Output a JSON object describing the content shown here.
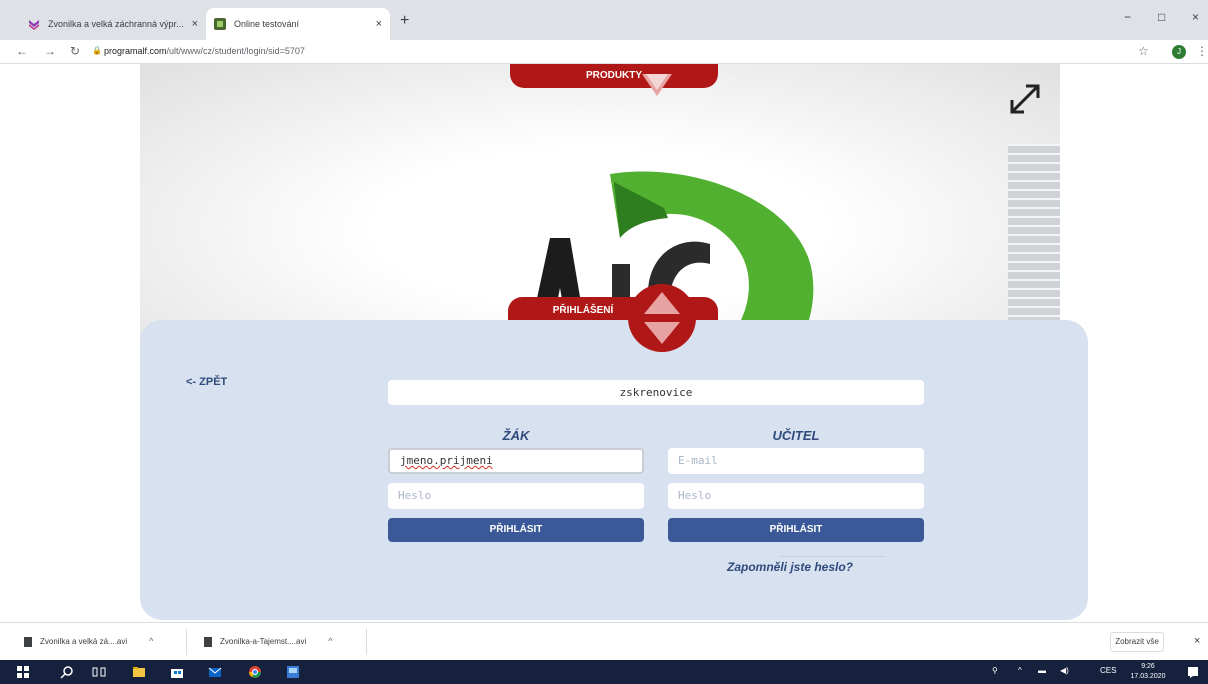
{
  "browser": {
    "tabs": [
      {
        "title": "Zvonilka a velká záchranná výpr...",
        "close": "×"
      },
      {
        "title": "Online testování",
        "close": "×"
      }
    ],
    "new_tab": "+",
    "url_host": "programalf.com",
    "url_path": "/ult/www/cz/student/login/sid=5707",
    "profile_initial": "J",
    "window_controls": {
      "minimize": "−",
      "maximize": "□",
      "close": "×"
    }
  },
  "page": {
    "produkty_label": "PRODUKTY",
    "prihlaseni_label": "PŘIHLÁŠENÍ",
    "back_label": "<- ZPĚT",
    "school_value": "zskrenovice",
    "student": {
      "heading": "ŽÁK",
      "name_value": "jmeno.prijmeni",
      "password_placeholder": "Heslo",
      "submit_label": "PŘIHLÁSIT"
    },
    "teacher": {
      "heading": "UČITEL",
      "email_placeholder": "E-mail",
      "password_placeholder": "Heslo",
      "submit_label": "PŘIHLÁSIT"
    },
    "forgot_label": "Zapomněli jste heslo?"
  },
  "downloads": {
    "items": [
      {
        "name": "Zvonilka a velká zá....avi"
      },
      {
        "name": "Zvonilka-a-Tajemst....avi"
      }
    ],
    "show_all": "Zobrazit vše",
    "close": "×"
  },
  "taskbar": {
    "lang": "CES",
    "time": "9:26",
    "date": "17.03.2020"
  },
  "colors": {
    "brand_red": "#b01818",
    "panel_bg": "#d8e1ef",
    "button_blue": "#3b5998",
    "heading_blue": "#2f4a7d",
    "logo_green": "#52b030"
  }
}
